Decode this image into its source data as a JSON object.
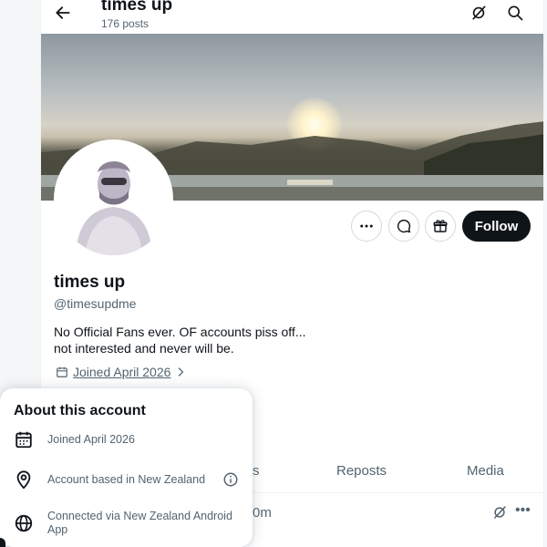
{
  "header": {
    "name": "times up",
    "posts": "176 posts"
  },
  "profile": {
    "name": "times up",
    "handle": "@timesupdme",
    "bio_line1": "No Official Fans ever. OF accounts piss off...",
    "bio_line2": "not interested and never will be.",
    "joined": "Joined April 2026",
    "follow_label": "Follow"
  },
  "tabs": {
    "partial": "s",
    "reposts": "Reposts",
    "media": "Media"
  },
  "post": {
    "meta": "0m"
  },
  "about_card": {
    "title": "About this account",
    "joined": "Joined April 2026",
    "based": "Account based in New Zealand",
    "connected_line1": "Connected via New Zealand Android",
    "connected_line2": "App"
  },
  "colors": {
    "accent": "#0f1419",
    "muted": "#536471",
    "border": "#cfd9de"
  },
  "icons": [
    "back-arrow-icon",
    "grok-icon",
    "search-icon",
    "more-icon",
    "message-icon",
    "subscribe-icon",
    "calendar-icon",
    "location-icon",
    "info-icon",
    "globe-icon",
    "chevron-right-icon"
  ]
}
